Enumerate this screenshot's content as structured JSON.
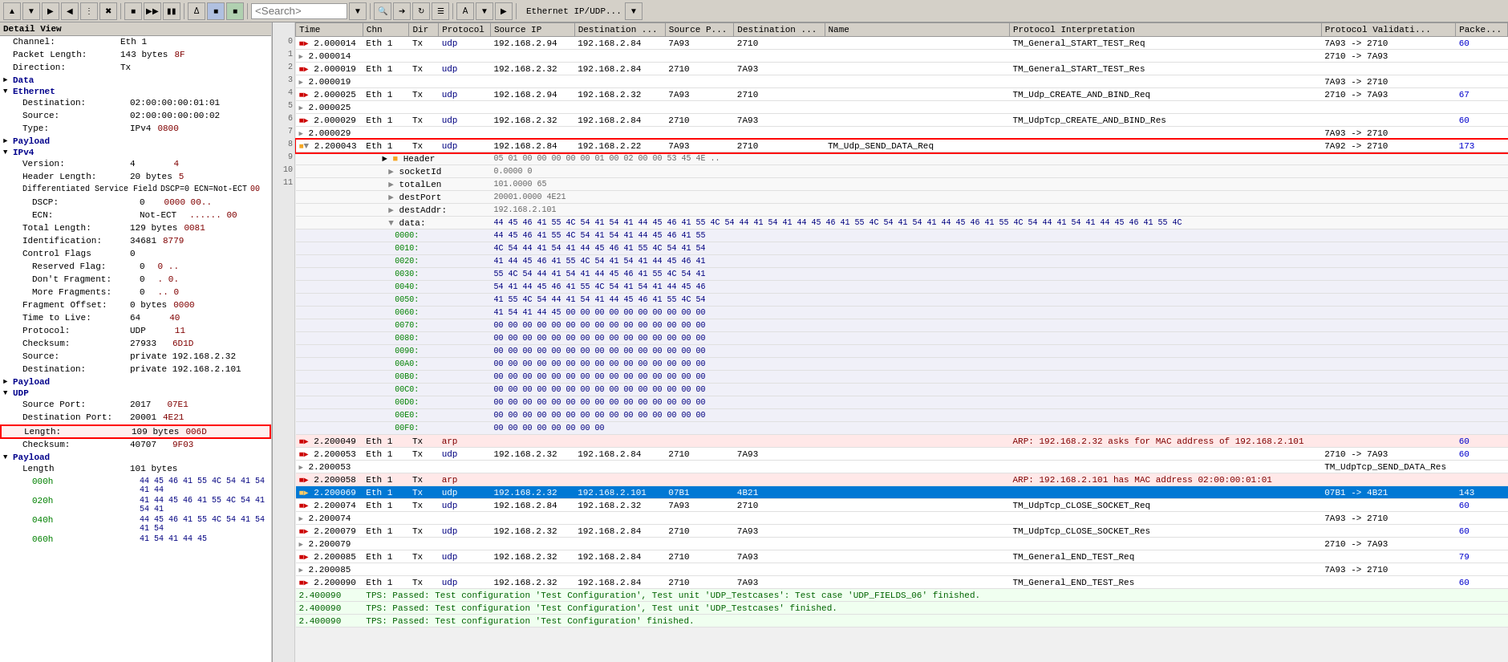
{
  "toolbar": {
    "search_placeholder": "<Search>",
    "title": "Ethernet IP/UDP..."
  },
  "detail_view": {
    "title": "Detail View",
    "sections": [
      {
        "label": "Channel:",
        "value": "Eth 1",
        "indent": 1
      },
      {
        "label": "Packet Length:",
        "value": "143 bytes",
        "hex": "8F",
        "indent": 1
      },
      {
        "label": "Direction:",
        "value": "Tx",
        "indent": 1
      },
      {
        "label": "Data",
        "is_section": true,
        "indent": 1
      },
      {
        "label": "Ethernet",
        "is_section": true,
        "indent": 0
      },
      {
        "label": "Destination:",
        "value": "02:00:00:00:01:01",
        "indent": 2
      },
      {
        "label": "Source:",
        "value": "02:00:00:00:00:02",
        "indent": 2
      },
      {
        "label": "Type:",
        "value": "IPv4",
        "hex": "0800",
        "indent": 2
      },
      {
        "label": "Payload",
        "is_section": true,
        "indent": 1
      },
      {
        "label": "IPv4",
        "is_section": true,
        "indent": 0
      },
      {
        "label": "Version:",
        "value": "4",
        "hex": "4",
        "indent": 2
      },
      {
        "label": "Header Length:",
        "value": "20 bytes",
        "hex": "5",
        "indent": 2
      },
      {
        "label": "Differentiated Service Field",
        "value": "DSCP=0 ECN=Not-ECT",
        "hex": "00",
        "indent": 2
      },
      {
        "label": "DSCP:",
        "value": "0",
        "hex": "0000 00..",
        "indent": 3
      },
      {
        "label": "ECN:",
        "value": "Not-ECT",
        "hex": "...... 00",
        "indent": 3
      },
      {
        "label": "Total Length:",
        "value": "129 bytes",
        "hex": "0081",
        "indent": 2
      },
      {
        "label": "Identification:",
        "value": "34681",
        "hex": "8779",
        "indent": 2
      },
      {
        "label": "Control Flags",
        "value": "0",
        "indent": 2
      },
      {
        "label": "Reserved Flag:",
        "value": "0",
        "hex": "0 ..",
        "indent": 3
      },
      {
        "label": "Don't Fragment:",
        "value": "0",
        "hex": ". 0.",
        "indent": 3
      },
      {
        "label": "More Fragments:",
        "value": "0",
        "hex": ".. 0",
        "indent": 3
      },
      {
        "label": "Fragment Offset:",
        "value": "0 bytes",
        "hex": "0000",
        "indent": 2
      },
      {
        "label": "Time to Live:",
        "value": "64",
        "hex": "40",
        "indent": 2
      },
      {
        "label": "Protocol:",
        "value": "UDP",
        "hex": "11",
        "indent": 2
      },
      {
        "label": "Checksum:",
        "value": "27933",
        "hex": "6D1D",
        "indent": 2
      },
      {
        "label": "Source:",
        "value": "private  192.168.2.32",
        "indent": 2
      },
      {
        "label": "Destination:",
        "value": "private  192.168.2.101",
        "indent": 2
      },
      {
        "label": "Payload",
        "is_section": true,
        "indent": 1
      },
      {
        "label": "UDP",
        "is_section": true,
        "indent": 0
      },
      {
        "label": "Source Port:",
        "value": "2017",
        "hex": "07E1",
        "indent": 2
      },
      {
        "label": "Destination Port:",
        "value": "20001",
        "hex": "4E21",
        "indent": 2
      },
      {
        "label": "Length:",
        "value": "109 bytes",
        "hex": "006D",
        "indent": 2,
        "highlighted": true
      },
      {
        "label": "Checksum:",
        "value": "40707",
        "hex": "9F03",
        "indent": 2
      },
      {
        "label": "Payload",
        "is_section": true,
        "indent": 1
      },
      {
        "label": "Length",
        "value": "101 bytes",
        "indent": 2
      },
      {
        "label": "000h",
        "value": "44 45 46 41 55 4C 54 41 54 41 44",
        "indent": 3
      },
      {
        "label": "020h",
        "value": "41 44 45 46 41 55 4C 54 41 54 41",
        "indent": 3
      },
      {
        "label": "040h",
        "value": "44 45 46 41 55 4C 54 41 54 41 54",
        "indent": 3
      },
      {
        "label": "060h",
        "value": "41 54 41 44 45",
        "indent": 3
      }
    ]
  },
  "columns": [
    "Time",
    "Chn",
    "Dir",
    "Protocol",
    "Source IP",
    "Destination ...",
    "Source P...",
    "Destination ...",
    "Name",
    "Protocol Interpretation",
    "Protocol Validati...",
    "Packe..."
  ],
  "packets": [
    {
      "time": "2.000014",
      "chn": "Eth 1",
      "dir": "Tx",
      "proto": "udp",
      "src": "192.168.2.94",
      "dst": "192.168.2.84",
      "srcp": "7A93",
      "dstp": "2710",
      "name": "",
      "interp": "TM_General_START_TEST_Req",
      "valid": "7A93 -> 2710",
      "pack": "60",
      "type": "normal"
    },
    {
      "time": "2.000014",
      "chn": "",
      "dir": "",
      "proto": "",
      "src": "",
      "dst": "",
      "srcp": "",
      "dstp": "",
      "name": "",
      "interp": "",
      "valid": "2710 -> 7A93",
      "pack": "",
      "type": "normal"
    },
    {
      "time": "2.000019",
      "chn": "Eth 1",
      "dir": "Tx",
      "proto": "udp",
      "src": "192.168.2.32",
      "dst": "192.168.2.84",
      "srcp": "2710",
      "dstp": "7A93",
      "name": "",
      "interp": "TM_General_START_TEST_Res",
      "valid": "",
      "pack": "",
      "type": "normal"
    },
    {
      "time": "2.000019",
      "chn": "",
      "dir": "",
      "proto": "",
      "src": "",
      "dst": "",
      "srcp": "",
      "dstp": "",
      "name": "",
      "interp": "",
      "valid": "7A93 -> 2710",
      "pack": "",
      "type": "normal"
    },
    {
      "time": "2.000025",
      "chn": "Eth 1",
      "dir": "Tx",
      "proto": "udp",
      "src": "192.168.2.94",
      "dst": "192.168.2.32",
      "srcp": "7A93",
      "dstp": "2710",
      "name": "",
      "interp": "TM_Udp_CREATE_AND_BIND_Req",
      "valid": "2710 -> 7A93",
      "pack": "67",
      "type": "normal"
    },
    {
      "time": "2.000025",
      "chn": "",
      "dir": "",
      "proto": "",
      "src": "",
      "dst": "",
      "srcp": "",
      "dstp": "",
      "name": "",
      "interp": "",
      "valid": "",
      "pack": "",
      "type": "normal"
    },
    {
      "time": "2.000029",
      "chn": "Eth 1",
      "dir": "Tx",
      "proto": "udp",
      "src": "192.168.2.32",
      "dst": "192.168.2.84",
      "srcp": "2710",
      "dstp": "7A93",
      "name": "",
      "interp": "TM_UdpTcp_CREATE_AND_BIND_Res",
      "valid": "",
      "pack": "60",
      "type": "normal"
    },
    {
      "time": "2.000029",
      "chn": "",
      "dir": "",
      "proto": "",
      "src": "",
      "dst": "",
      "srcp": "",
      "dstp": "",
      "name": "",
      "interp": "",
      "valid": "7A93 -> 2710",
      "pack": "",
      "type": "normal"
    },
    {
      "time": "2.000043",
      "chn": "Eth 1",
      "dir": "Tx",
      "proto": "udp",
      "src": "192.168.2.84",
      "dst": "192.168.2.22",
      "srcp": "7A93",
      "dstp": "2710",
      "name": "TM_Udp_SEND_DATA_Req",
      "interp": "",
      "valid": "7A92 -> 2710",
      "pack": "173",
      "type": "expanded",
      "red_border": true
    },
    {
      "time": "",
      "chn": "",
      "dir": "",
      "proto": "",
      "src": "",
      "dst": "",
      "srcp": "",
      "dstp": "",
      "name": "Header",
      "interp": "05 01 00 00 00 00 00 01 00 02 00 00 53 45 4E ..",
      "valid": "",
      "pack": "",
      "type": "sub"
    },
    {
      "time": "",
      "chn": "",
      "dir": "",
      "proto": "",
      "src": "",
      "dst": "",
      "srcp": "",
      "dstp": "",
      "name": "socketId",
      "interp": "0.0000          0",
      "valid": "",
      "pack": "",
      "type": "sub"
    },
    {
      "time": "",
      "chn": "",
      "dir": "",
      "proto": "",
      "src": "",
      "dst": "",
      "srcp": "",
      "dstp": "",
      "name": "totalLen",
      "interp": "101.0000         65",
      "valid": "",
      "pack": "",
      "type": "sub"
    },
    {
      "time": "",
      "chn": "",
      "dir": "",
      "proto": "",
      "src": "",
      "dst": "",
      "srcp": "",
      "dstp": "",
      "name": "destPort",
      "interp": "20001.0000       4E21",
      "valid": "",
      "pack": "",
      "type": "sub"
    },
    {
      "time": "",
      "chn": "",
      "dir": "",
      "proto": "",
      "src": "",
      "dst": "",
      "srcp": "",
      "dstp": "",
      "name": "destAddr:",
      "interp": "192.168.2.101",
      "valid": "",
      "pack": "",
      "type": "sub"
    },
    {
      "time": "",
      "chn": "",
      "dir": "",
      "proto": "",
      "src": "",
      "dst": "",
      "srcp": "",
      "dstp": "",
      "name": "data:",
      "interp": "44 45 46 41 55 4C 54 41 54 41 44 45 46 41 55 4C 54 44 41 54 41 44 45 46 41 55 4C 54 41 54 41 44 45 46 41 55 4C 54 44 41 54 41 44 45 46 41 55 4C",
      "valid": "",
      "pack": "",
      "type": "sub-data"
    },
    {
      "time": "",
      "addr": "0000:",
      "bytes": "44 45 46 41 55 4C 54 41 54 41 44 45 46 41 55",
      "type": "hex"
    },
    {
      "time": "",
      "addr": "0010:",
      "bytes": "4C 54 44 41 54 41 44 45 46 41 55 4C 54 41 54",
      "type": "hex"
    },
    {
      "time": "",
      "addr": "0020:",
      "bytes": "41 44 45 46 41 55 4C 54 41 54 41 44 45 46 41",
      "type": "hex"
    },
    {
      "time": "",
      "addr": "0030:",
      "bytes": "55 4C 54 44 41 54 41 44 45 46 41 55 4C 54 41",
      "type": "hex"
    },
    {
      "time": "",
      "addr": "0040:",
      "bytes": "54 41 44 45 46 41 55 4C 54 41 54 41 44 45 46",
      "type": "hex"
    },
    {
      "time": "",
      "addr": "0050:",
      "bytes": "41 55 4C 54 44 41 54 41 44 45 46 41 55 4C 54",
      "type": "hex"
    },
    {
      "time": "",
      "addr": "0060:",
      "bytes": "41 54 41 44 45 00 00 00 00 00 00 00 00 00 00",
      "type": "hex"
    },
    {
      "time": "",
      "addr": "0070:",
      "bytes": "00 00 00 00 00 00 00 00 00 00 00 00 00 00 00",
      "type": "hex"
    },
    {
      "time": "",
      "addr": "0080:",
      "bytes": "00 00 00 00 00 00 00 00 00 00 00 00 00 00 00",
      "type": "hex"
    },
    {
      "time": "",
      "addr": "0090:",
      "bytes": "00 00 00 00 00 00 00 00 00 00 00 00 00 00 00",
      "type": "hex"
    },
    {
      "time": "",
      "addr": "00A0:",
      "bytes": "00 00 00 00 00 00 00 00 00 00 00 00 00 00 00",
      "type": "hex"
    },
    {
      "time": "",
      "addr": "00B0:",
      "bytes": "00 00 00 00 00 00 00 00 00 00 00 00 00 00 00",
      "type": "hex"
    },
    {
      "time": "",
      "addr": "00C0:",
      "bytes": "00 00 00 00 00 00 00 00 00 00 00 00 00 00 00",
      "type": "hex"
    },
    {
      "time": "",
      "addr": "00D0:",
      "bytes": "00 00 00 00 00 00 00 00 00 00 00 00 00 00 00",
      "type": "hex"
    },
    {
      "time": "",
      "addr": "00E0:",
      "bytes": "00 00 00 00 00 00 00 00 00 00 00 00 00 00 00",
      "type": "hex"
    },
    {
      "time": "",
      "addr": "00F0:",
      "bytes": "00 00 00 00 00 00 00 00",
      "type": "hex"
    },
    {
      "time": "2.200049",
      "chn": "Eth 1",
      "dir": "Tx",
      "proto": "arp",
      "src": "",
      "dst": "",
      "srcp": "",
      "dstp": "",
      "name": "",
      "interp": "ARP: 192.168.2.32 asks for MAC address of 192.168.2.101",
      "valid": "",
      "pack": "60",
      "type": "arp"
    },
    {
      "time": "2.200053",
      "chn": "Eth 1",
      "dir": "Tx",
      "proto": "udp",
      "src": "192.168.2.32",
      "dst": "192.168.2.84",
      "srcp": "2710",
      "dstp": "7A93",
      "name": "",
      "interp": "",
      "valid": "2710 -> 7A93",
      "pack": "60",
      "type": "normal"
    },
    {
      "time": "2.200053",
      "chn": "",
      "dir": "",
      "proto": "",
      "src": "",
      "dst": "",
      "srcp": "",
      "dstp": "",
      "name": "",
      "interp": "TM_UdpTcp_SEND_DATA_Res",
      "valid": "",
      "pack": "",
      "type": "normal"
    },
    {
      "time": "2.200058",
      "chn": "Eth 1",
      "dir": "Tx",
      "proto": "arp",
      "src": "",
      "dst": "",
      "srcp": "",
      "dstp": "",
      "name": "",
      "interp": "ARP: 192.168.2.101 has MAC address 02:00:00:01:01",
      "valid": "",
      "pack": "",
      "type": "arp"
    },
    {
      "time": "2.200069",
      "chn": "Eth 1",
      "dir": "Tx",
      "proto": "udp",
      "src": "192.168.2.32",
      "dst": "192.168.2.101",
      "srcp": "07B1",
      "dstp": "4B21",
      "name": "",
      "interp": "",
      "valid": "07B1 -> 4B21",
      "pack": "143",
      "type": "selected"
    },
    {
      "time": "2.200074",
      "chn": "Eth 1",
      "dir": "Tx",
      "proto": "udp",
      "src": "192.168.2.84",
      "dst": "192.168.2.32",
      "srcp": "7A93",
      "dstp": "2710",
      "name": "",
      "interp": "TM_UdpTcp_CLOSE_SOCKET_Req",
      "valid": "",
      "pack": "60",
      "type": "normal"
    },
    {
      "time": "2.200074",
      "chn": "",
      "dir": "",
      "proto": "",
      "src": "",
      "dst": "",
      "srcp": "",
      "dstp": "",
      "name": "",
      "interp": "",
      "valid": "7A93 -> 2710",
      "pack": "",
      "type": "normal"
    },
    {
      "time": "2.200079",
      "chn": "Eth 1",
      "dir": "Tx",
      "proto": "udp",
      "src": "192.168.2.32",
      "dst": "192.168.2.84",
      "srcp": "2710",
      "dstp": "7A93",
      "name": "",
      "interp": "TM_UdpTcp_CLOSE_SOCKET_Res",
      "valid": "",
      "pack": "60",
      "type": "normal"
    },
    {
      "time": "2.200079",
      "chn": "",
      "dir": "",
      "proto": "",
      "src": "",
      "dst": "",
      "srcp": "",
      "dstp": "",
      "name": "",
      "interp": "",
      "valid": "2710 -> 7A93",
      "pack": "",
      "type": "normal"
    },
    {
      "time": "2.200085",
      "chn": "Eth 1",
      "dir": "Tx",
      "proto": "udp",
      "src": "192.168.2.32",
      "dst": "192.168.2.84",
      "srcp": "2710",
      "dstp": "7A93",
      "name": "",
      "interp": "TM_General_END_TEST_Req",
      "valid": "",
      "pack": "79",
      "type": "normal"
    },
    {
      "time": "2.200085",
      "chn": "",
      "dir": "",
      "proto": "",
      "src": "",
      "dst": "",
      "srcp": "",
      "dstp": "",
      "name": "",
      "interp": "",
      "valid": "7A93 -> 2710",
      "pack": "",
      "type": "normal"
    },
    {
      "time": "2.200090",
      "chn": "Eth 1",
      "dir": "Tx",
      "proto": "udp",
      "src": "192.168.2.32",
      "dst": "192.168.2.84",
      "srcp": "2710",
      "dstp": "7A93",
      "name": "",
      "interp": "TM_General_END_TEST_Res",
      "valid": "",
      "pack": "60",
      "type": "normal"
    },
    {
      "time": "2.400090",
      "chn": "",
      "dir": "",
      "proto": "",
      "src": "",
      "dst": "",
      "srcp": "",
      "dstp": "",
      "name": "",
      "interp": "TPS: Passed: Test configuration 'Test Configuration', Test unit 'UDP_Testcases': Test case 'UDP_FIELDS_06' finished.",
      "valid": "",
      "pack": "",
      "type": "info"
    },
    {
      "time": "2.400090",
      "chn": "",
      "dir": "",
      "proto": "",
      "src": "",
      "dst": "",
      "srcp": "",
      "dstp": "",
      "name": "",
      "interp": "TPS: Passed: Test configuration 'Test Configuration', Test unit 'UDP_Testcases' finished.",
      "valid": "",
      "pack": "",
      "type": "info"
    },
    {
      "time": "2.400090",
      "chn": "",
      "dir": "",
      "proto": "",
      "src": "",
      "dst": "",
      "srcp": "",
      "dstp": "",
      "name": "",
      "interp": "TPS: Passed: Test configuration 'Test Configuration' finished.",
      "valid": "",
      "pack": "",
      "type": "info"
    }
  ],
  "hex_rows": [
    {
      "addr": "000h",
      "bytes": "44 45 46 41 55 4C 54 41 54 41 44"
    },
    {
      "addr": "020h",
      "bytes": "41 44 45 46 41 55 4C 54 41 54 41"
    },
    {
      "addr": "040h",
      "bytes": "44 45 46 41 55 4C 54 41 54 41 54"
    },
    {
      "addr": "060h",
      "bytes": "41 54 41 44 45"
    }
  ],
  "colors": {
    "selected_row": "#0078d4",
    "arp_row": "#ffe8e8",
    "info_text": "#006400",
    "header_bg": "#d4d0c8",
    "highlight_red": "#ff0000",
    "normal_bg": "#ffffff"
  }
}
